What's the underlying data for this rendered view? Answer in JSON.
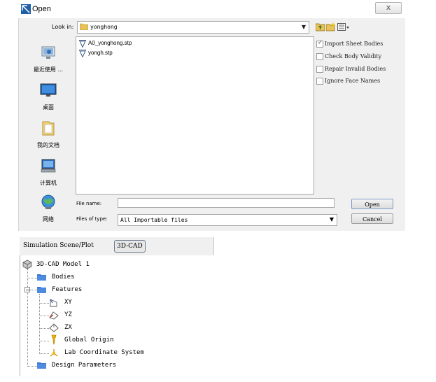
{
  "dialog": {
    "title": "Open",
    "close_label": "x",
    "look_in_label": "Look in:",
    "look_in_value": "yonghong",
    "places": [
      {
        "label": "最近使用 ...",
        "icon": "recent-items-icon"
      },
      {
        "label": "桌面",
        "icon": "desktop-icon"
      },
      {
        "label": "我的文档",
        "icon": "my-documents-icon"
      },
      {
        "label": "计算机",
        "icon": "computer-icon"
      },
      {
        "label": "网络",
        "icon": "network-icon"
      }
    ],
    "files": [
      {
        "name": "A0_yonghong.stp",
        "icon": "step-file-icon"
      },
      {
        "name": "yongh.stp",
        "icon": "step-file-icon"
      }
    ],
    "options": [
      {
        "label": "Import Sheet Bodies",
        "checked": true
      },
      {
        "label": "Check Body Validity",
        "checked": false
      },
      {
        "label": "Repair Invalid Bodies",
        "checked": false
      },
      {
        "label": "Ignore Face Names",
        "checked": false
      }
    ],
    "file_name_label": "File name:",
    "file_name_value": "",
    "file_type_label": "Files of type:",
    "file_type_value": "All Importable files",
    "open_label": "Open",
    "cancel_label": "Cancel",
    "check_mark": "✓",
    "dropdown_arrow": "▼"
  },
  "tree": {
    "tabs": [
      "Simulation Scene/Plot",
      "3D-CAD"
    ],
    "root": "3D-CAD Model 1",
    "bodies": "Bodies",
    "features": "Features",
    "feature_items": [
      "XY",
      "YZ",
      "ZX",
      "Global Origin",
      "Lab Coordinate System"
    ],
    "design_parameters": "Design Parameters",
    "expander_minus": "−"
  },
  "colors": {
    "folder_blue": "#3a78d4",
    "dialog_bg": "#f0f0f0",
    "button_border": "#7a9cc7"
  }
}
